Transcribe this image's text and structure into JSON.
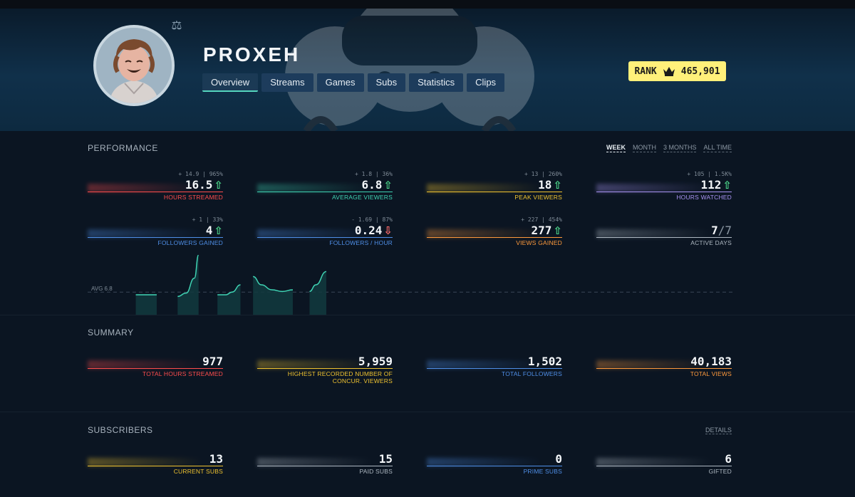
{
  "channel": {
    "name": "PROXEH"
  },
  "tabs": [
    {
      "label": "Overview"
    },
    {
      "label": "Streams"
    },
    {
      "label": "Games"
    },
    {
      "label": "Subs"
    },
    {
      "label": "Statistics"
    },
    {
      "label": "Clips"
    }
  ],
  "rank": {
    "label": "RANK",
    "value": "465,901",
    "icon": "crown-icon"
  },
  "performance": {
    "title": "PERFORMANCE",
    "periods": [
      "WEEK",
      "MONTH",
      "3 MONTHS",
      "ALL TIME"
    ],
    "stats": [
      {
        "delta": "+ 14.9 | 965%",
        "value": "16.5",
        "trend": "up",
        "label": "HOURS STREAMED",
        "color": "#ff4d4d"
      },
      {
        "delta": "+ 1.8 | 36%",
        "value": "6.8",
        "trend": "up",
        "label": "AVERAGE VIEWERS",
        "color": "#3fd3b3"
      },
      {
        "delta": "+ 13 | 260%",
        "value": "18",
        "trend": "up",
        "label": "PEAK VIEWERS",
        "color": "#f0c330"
      },
      {
        "delta": "+ 105 | 1.5K%",
        "value": "112",
        "trend": "up",
        "label": "HOURS WATCHED",
        "color": "#a893f2"
      },
      {
        "delta": "+ 1 | 33%",
        "value": "4",
        "trend": "up",
        "label": "FOLLOWERS GAINED",
        "color": "#4f8fe8"
      },
      {
        "delta": "- 1.69 | 87%",
        "value": "0.24",
        "trend": "down",
        "label": "FOLLOWERS / HOUR",
        "color": "#4f8fe8"
      },
      {
        "delta": "+ 227 | 454%",
        "value": "277",
        "trend": "up",
        "label": "VIEWS GAINED",
        "color": "#ff9a3c"
      },
      {
        "delta": "",
        "value": "7",
        "suffix": "/7",
        "trend": "",
        "label": "ACTIVE DAYS",
        "color": "#aeb8c2"
      }
    ],
    "chart_data": {
      "type": "area",
      "avg_label": "AVG 6.8",
      "avg": 6.8,
      "ylim": [
        0,
        18
      ],
      "segments": [
        {
          "x": [
            0,
            1
          ],
          "y": [
            6,
            6
          ]
        },
        {
          "x": [
            2,
            2.4,
            2.8,
            3
          ],
          "y": [
            5.5,
            6.5,
            11,
            18
          ]
        },
        {
          "x": [
            3.9,
            4.3,
            4.6,
            5
          ],
          "y": [
            6,
            6,
            6.8,
            9
          ]
        },
        {
          "x": [
            5.6,
            6,
            6.5,
            7,
            7.5
          ],
          "y": [
            11.5,
            9,
            7.5,
            7,
            7.5
          ]
        },
        {
          "x": [
            8.3,
            8.6,
            9.1
          ],
          "y": [
            7,
            9,
            13
          ]
        }
      ],
      "xlim": [
        -2.3,
        28.5
      ]
    }
  },
  "summary": {
    "title": "SUMMARY",
    "stats": [
      {
        "value": "977",
        "label": "TOTAL HOURS STREAMED",
        "color": "#ff4d4d"
      },
      {
        "value": "5,959",
        "label": "HIGHEST RECORDED NUMBER OF",
        "label2": "CONCUR. VIEWERS",
        "color": "#f0c330"
      },
      {
        "value": "1,502",
        "label": "TOTAL FOLLOWERS",
        "color": "#4f8fe8"
      },
      {
        "value": "40,183",
        "label": "TOTAL VIEWS",
        "color": "#ff9a3c"
      }
    ]
  },
  "subscribers": {
    "title": "SUBSCRIBERS",
    "details": "DETAILS",
    "stats": [
      {
        "value": "13",
        "label": "CURRENT SUBS",
        "color": "#f0c330"
      },
      {
        "value": "15",
        "label": "PAID SUBS",
        "color": "#aeb8c2"
      },
      {
        "value": "0",
        "label": "PRIME SUBS",
        "color": "#4f8fe8"
      },
      {
        "value": "6",
        "label": "GIFTED",
        "color": "#aeb8c2"
      }
    ]
  }
}
